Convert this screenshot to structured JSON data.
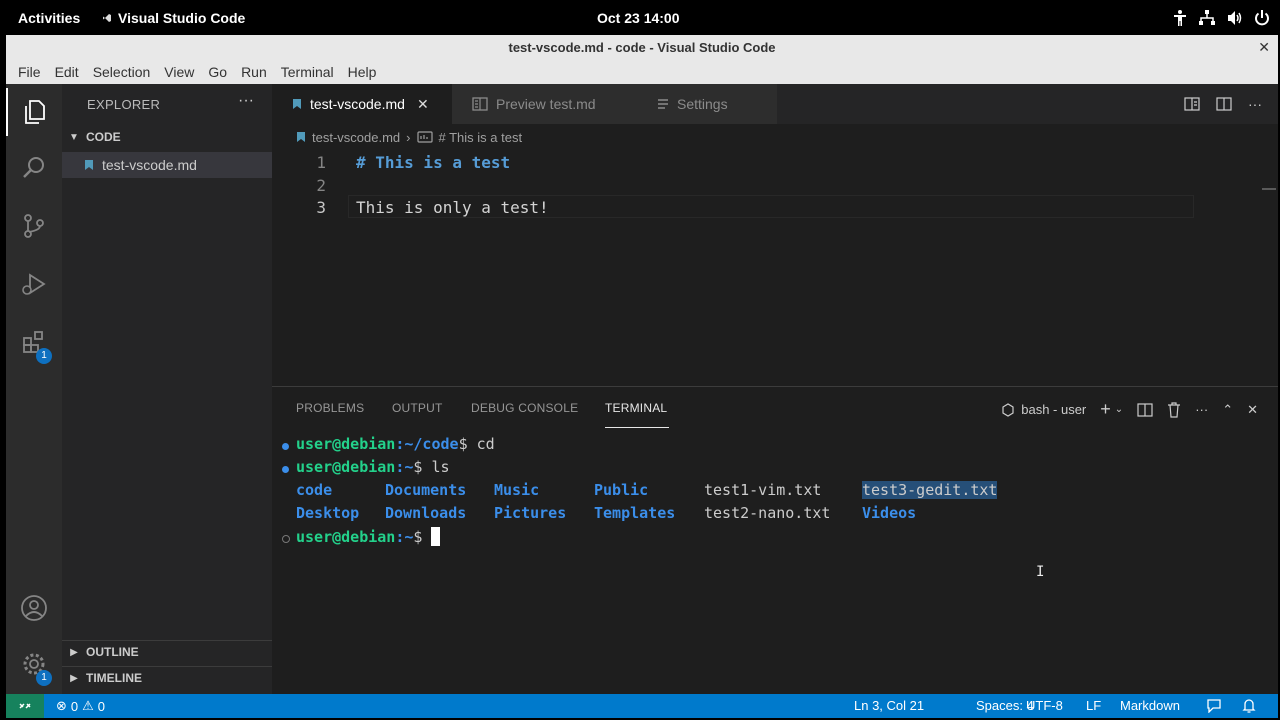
{
  "gnome": {
    "activities": "Activities",
    "app_name": "Visual Studio Code",
    "clock": "Oct 23  14:00"
  },
  "window": {
    "title": "test-vscode.md - code - Visual Studio Code"
  },
  "menu": [
    "File",
    "Edit",
    "Selection",
    "View",
    "Go",
    "Run",
    "Terminal",
    "Help"
  ],
  "activity": {
    "extensions_badge": "1",
    "settings_badge": "1"
  },
  "sidebar": {
    "title": "EXPLORER",
    "folder": "CODE",
    "file": "test-vscode.md",
    "outline": "OUTLINE",
    "timeline": "TIMELINE"
  },
  "tabs": [
    {
      "label": "test-vscode.md"
    },
    {
      "label": "Preview test.md"
    },
    {
      "label": "Settings"
    }
  ],
  "breadcrumb": {
    "file": "test-vscode.md",
    "symbol": "# This is a test"
  },
  "editor": {
    "lines": [
      {
        "num": "1",
        "text": "# This is a test"
      },
      {
        "num": "2",
        "text": ""
      },
      {
        "num": "3",
        "text": "This is only a test!"
      }
    ]
  },
  "panel": {
    "tabs": [
      "PROBLEMS",
      "OUTPUT",
      "DEBUG CONSOLE",
      "TERMINAL"
    ],
    "shell": "bash - user"
  },
  "terminal": {
    "prompt_user": "user@debian",
    "line1_path": ":~/code",
    "line1_cmd": "$ cd",
    "line2_path": ":~",
    "line2_cmd": "$ ls",
    "row1": [
      "code",
      "Documents",
      "Music",
      "Public",
      "test1-vim.txt",
      "test3-gedit.txt"
    ],
    "row2": [
      "Desktop",
      "Downloads",
      "Pictures",
      "Templates",
      "test2-nano.txt",
      "Videos"
    ],
    "line3_path": ":~",
    "line3_cmd": "$ "
  },
  "status": {
    "errors": "0",
    "warnings": "0",
    "position": "Ln 3, Col 21",
    "spaces": "Spaces: 4",
    "encoding": "UTF-8",
    "eol": "LF",
    "language": "Markdown"
  },
  "colors": {
    "accent": "#007acc",
    "remote": "#16825d",
    "prompt_green": "#23d18b",
    "dir_blue": "#3b8eea"
  }
}
